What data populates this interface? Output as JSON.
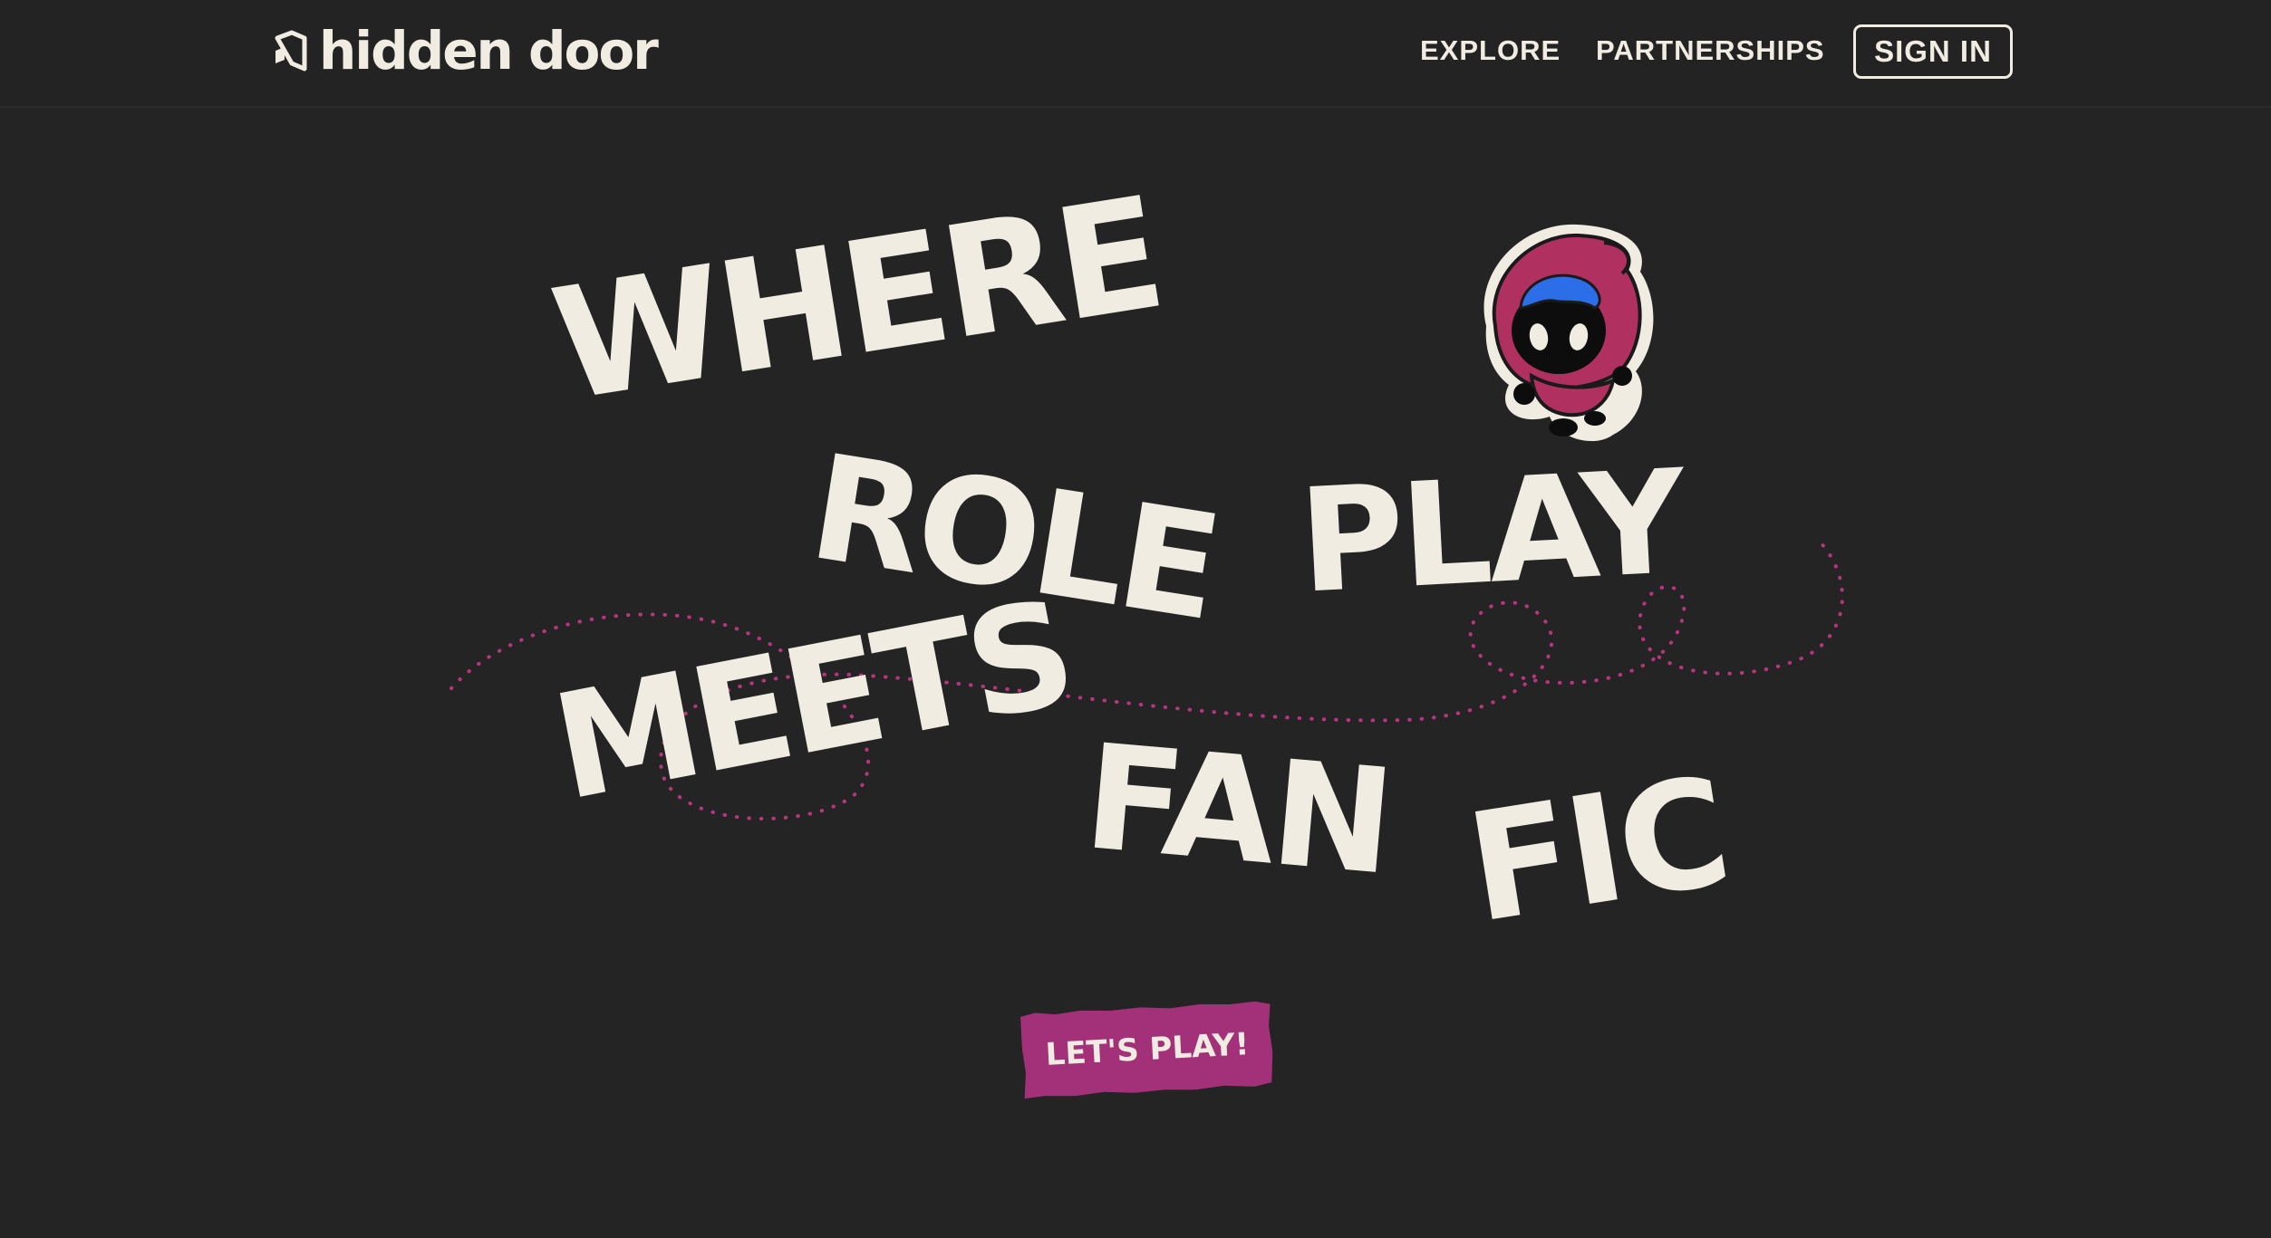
{
  "header": {
    "logo_text": "hidden door",
    "nav": {
      "explore": "EXPLORE",
      "partnerships": "PARTNERSHIPS"
    },
    "sign_in": "SIGN IN"
  },
  "hero": {
    "words": {
      "where": "WHERE",
      "role": "ROLE",
      "play": "PLAY",
      "meets": "MEETS",
      "fan": "FAN",
      "fic": "FIC"
    },
    "cta": "LET'S PLAY!"
  },
  "colors": {
    "background": "#242424",
    "text": "#f1ece2",
    "accent": "#a2317a",
    "mascot_hood": "#b0315f",
    "mascot_hair": "#2b6ee8"
  },
  "icons": {
    "logo": "hidden-door-logo-icon",
    "mascot": "hooded-mascot-icon"
  }
}
